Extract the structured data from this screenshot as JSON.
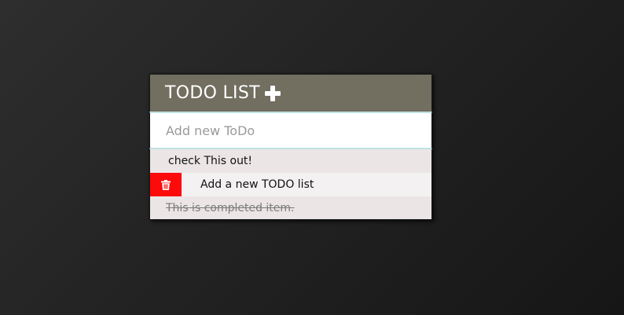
{
  "header": {
    "title": "TODO LIST",
    "add_icon": "plus-icon"
  },
  "input": {
    "placeholder": "Add new ToDo",
    "value": ""
  },
  "todos": [
    {
      "text": "check This out!",
      "completed": false,
      "delete_visible": false
    },
    {
      "text": "Add a new TODO list",
      "completed": false,
      "delete_visible": true,
      "delete_icon": "trash-icon"
    },
    {
      "text": "This is completed item.",
      "completed": true,
      "delete_visible": false
    }
  ],
  "colors": {
    "header_bg": "#726e60",
    "delete_bg": "#fd0a0a",
    "item_odd_bg": "#ece5e5",
    "item_even_bg": "#f3f1f1",
    "input_border": "#bfe3e1"
  }
}
